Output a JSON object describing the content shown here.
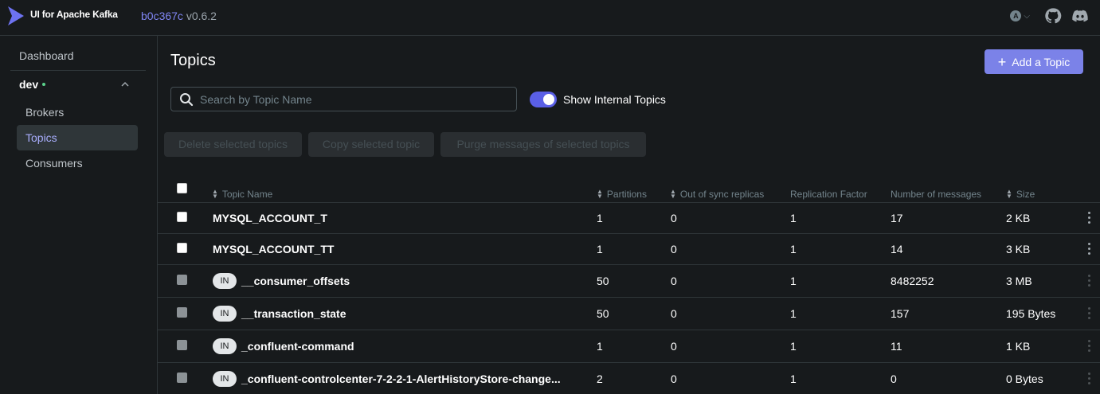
{
  "header": {
    "brand": "UI for Apache Kafka",
    "commit": "b0c367c",
    "version": "v0.6.2",
    "user_initial": "A"
  },
  "sidebar": {
    "dashboard": "Dashboard",
    "cluster": "dev",
    "items": [
      {
        "label": "Brokers",
        "active": false
      },
      {
        "label": "Topics",
        "active": true
      },
      {
        "label": "Consumers",
        "active": false
      }
    ]
  },
  "main": {
    "title": "Topics",
    "add_button": "Add a Topic",
    "search_placeholder": "Search by Topic Name",
    "show_internal_label": "Show Internal Topics",
    "show_internal_on": true,
    "bulk": {
      "delete": "Delete selected topics",
      "copy": "Copy selected topic",
      "purge": "Purge messages of selected topics"
    }
  },
  "table": {
    "columns": [
      "Topic Name",
      "Partitions",
      "Out of sync replicas",
      "Replication Factor",
      "Number of messages",
      "Size"
    ],
    "internal_badge": "IN",
    "rows": [
      {
        "name": "MYSQL_ACCOUNT_T",
        "internal": false,
        "partitions": "1",
        "out_of_sync": "0",
        "replication": "1",
        "messages": "17",
        "size": "2 KB"
      },
      {
        "name": "MYSQL_ACCOUNT_TT",
        "internal": false,
        "partitions": "1",
        "out_of_sync": "0",
        "replication": "1",
        "messages": "14",
        "size": "3 KB"
      },
      {
        "name": "__consumer_offsets",
        "internal": true,
        "partitions": "50",
        "out_of_sync": "0",
        "replication": "1",
        "messages": "8482252",
        "size": "3 MB"
      },
      {
        "name": "__transaction_state",
        "internal": true,
        "partitions": "50",
        "out_of_sync": "0",
        "replication": "1",
        "messages": "157",
        "size": "195 Bytes"
      },
      {
        "name": "_confluent-command",
        "internal": true,
        "partitions": "1",
        "out_of_sync": "0",
        "replication": "1",
        "messages": "11",
        "size": "1 KB"
      },
      {
        "name": "_confluent-controlcenter-7-2-2-1-AlertHistoryStore-change...",
        "internal": true,
        "partitions": "2",
        "out_of_sync": "0",
        "replication": "1",
        "messages": "0",
        "size": "0 Bytes"
      }
    ]
  }
}
